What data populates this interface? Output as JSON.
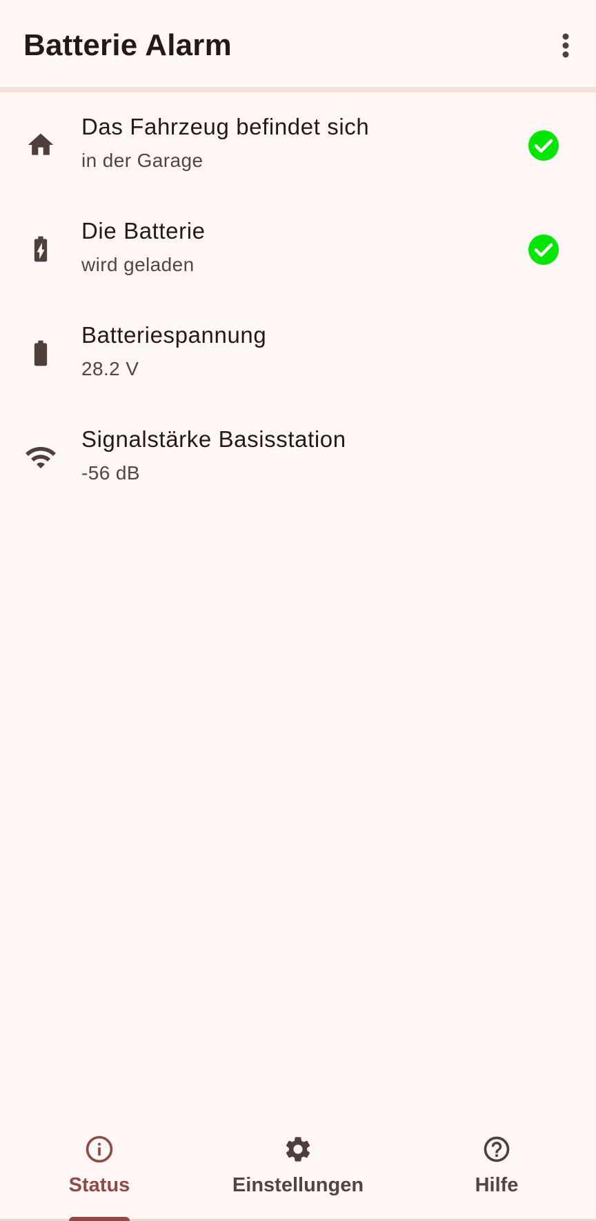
{
  "app_bar": {
    "title": "Batterie Alarm",
    "menu_icon": "more-vert-icon"
  },
  "status_items": [
    {
      "icon": "home-icon",
      "title": "Das Fahrzeug befindet sich",
      "subtitle": "in der Garage",
      "check": true
    },
    {
      "icon": "battery-charging-icon",
      "title": "Die Batterie",
      "subtitle": "wird geladen",
      "check": true
    },
    {
      "icon": "battery-full-icon",
      "title": "Batteriespannung",
      "subtitle": "28.2 V",
      "check": false
    },
    {
      "icon": "wifi-icon",
      "title": "Signalstärke Basisstation",
      "subtitle": "-56 dB",
      "check": false
    }
  ],
  "bottom_nav": {
    "active": "Status",
    "items": [
      {
        "label": "Status",
        "icon": "info-icon"
      },
      {
        "label": "Einstellungen",
        "icon": "gear-icon"
      },
      {
        "label": "Hilfe",
        "icon": "help-icon"
      }
    ]
  },
  "colors": {
    "background": "#fff8f6",
    "primary": "#904a44",
    "on_surface": "#231917",
    "on_surface_variant": "#534341",
    "icon": "#4e3f3d",
    "success": "#00e600"
  }
}
